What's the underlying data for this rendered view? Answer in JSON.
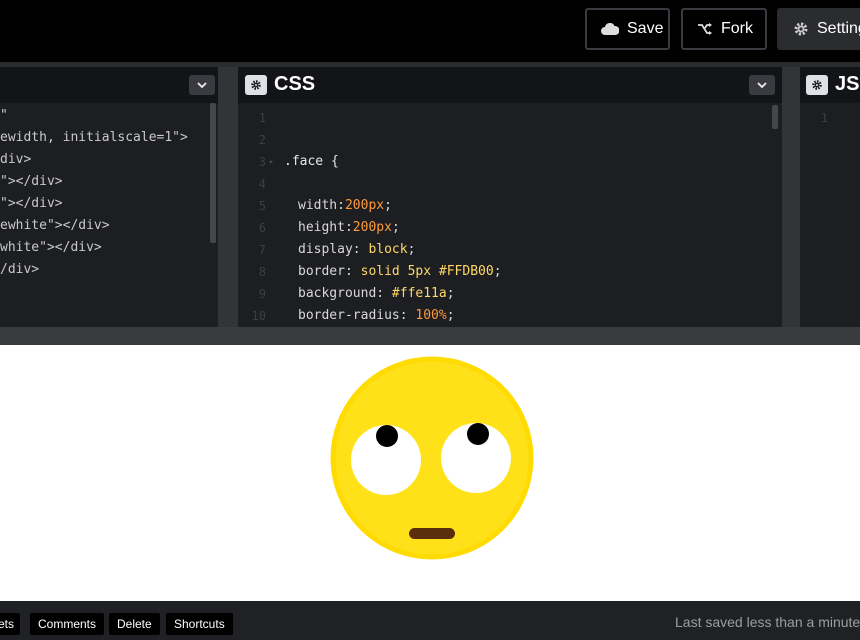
{
  "toolbar": {
    "save_label": "Save",
    "fork_label": "Fork",
    "settings_label": "Settings"
  },
  "editors": {
    "css": {
      "title": "CSS"
    },
    "js": {
      "title": "JS"
    }
  },
  "html_code": [
    {
      "p1": "\"",
      "p2": ""
    },
    {
      "p1": "ewidth, initialscale=1\">",
      "p2": ""
    },
    {
      "p1": "div>",
      "p2": ""
    },
    {
      "p1": "\"></div>",
      "p2": ""
    },
    {
      "p1": "\"></div>",
      "p2": ""
    },
    {
      "p1": "ewhite\"></div>",
      "p2": ""
    },
    {
      "p1": "white\"></div>",
      "p2": ""
    },
    {
      "p1": "/div>",
      "p2": ""
    }
  ],
  "css_code": [
    {
      "ln": "1"
    },
    {
      "ln": "2"
    },
    {
      "ln": "3",
      "sel": ".face {"
    },
    {
      "ln": "4"
    },
    {
      "ln": "5",
      "prop": "width:",
      "val": "200px",
      "vclass": "num",
      "end": ";"
    },
    {
      "ln": "6",
      "prop": "height:",
      "val": "200px",
      "vclass": "num",
      "end": ";"
    },
    {
      "ln": "7",
      "prop": "display: ",
      "val": "block",
      "vclass": "kw",
      "end": ";"
    },
    {
      "ln": "8",
      "prop": "border: ",
      "val": "solid 5px #FFDB00",
      "vclass": "hex",
      "end": ";"
    },
    {
      "ln": "9",
      "prop": "background: ",
      "val": "#ffe11a",
      "vclass": "hex",
      "end": ";"
    },
    {
      "ln": "10",
      "prop": "border-radius: ",
      "val": "100%",
      "vclass": "num",
      "end": ";"
    }
  ],
  "js_code": [
    {
      "ln": "1"
    }
  ],
  "preview": {
    "face_color": "#ffe11a",
    "face_border": "#FFDB00",
    "mouth_color": "#5a2d0c"
  },
  "bottom": {
    "buttons": [
      "ets",
      "Comments",
      "Delete",
      "Shortcuts"
    ],
    "status": "Last saved less than a minute"
  }
}
